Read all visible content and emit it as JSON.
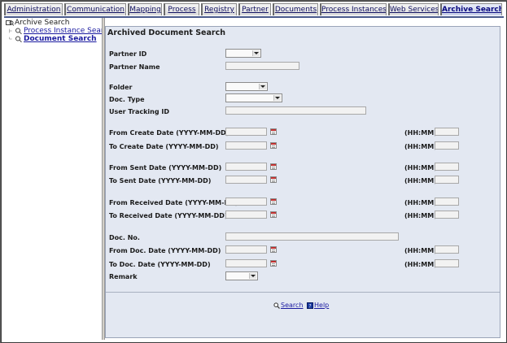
{
  "tabs": [
    {
      "label": "Administration",
      "active": false
    },
    {
      "label": "Communication",
      "active": false
    },
    {
      "label": "Mapping",
      "active": false
    },
    {
      "label": "Process",
      "active": false
    },
    {
      "label": "Registry",
      "active": false
    },
    {
      "label": "Partner",
      "active": false
    },
    {
      "label": "Documents",
      "active": false
    },
    {
      "label": "Process Instances",
      "active": false
    },
    {
      "label": "Web Services",
      "active": false
    },
    {
      "label": "Archive Search",
      "active": true
    }
  ],
  "tree": {
    "root": "Archive Search",
    "children": [
      "Process Instance Search",
      "Document Search"
    ]
  },
  "form": {
    "title": "Archived Document Search",
    "partner_id": "Partner ID",
    "partner_name": "Partner Name",
    "folder": "Folder",
    "doc_type": "Doc. Type",
    "user_tracking_id": "User Tracking ID",
    "from_create_date": "From Create Date (YYYY-MM-DD)",
    "to_create_date": "To Create Date (YYYY-MM-DD)",
    "from_sent_date": "From Sent Date (YYYY-MM-DD)",
    "to_sent_date": "To Sent Date (YYYY-MM-DD)",
    "from_received_date": "From Received Date (YYYY-MM-DD)",
    "to_received_date": "To Received Date (YYYY-MM-DD)",
    "doc_no": "Doc. No.",
    "from_doc_date": "From Doc. Date (YYYY-MM-DD)",
    "to_doc_date": "To Doc. Date (YYYY-MM-DD)",
    "remark": "Remark",
    "time_label": "(HH:MM)"
  },
  "actions": {
    "search": "Search",
    "help": "Help"
  },
  "colors": {
    "panel_bg": "#e3e8f2",
    "link": "#1a1aa0",
    "tab_underline": "#4a5a8c"
  }
}
